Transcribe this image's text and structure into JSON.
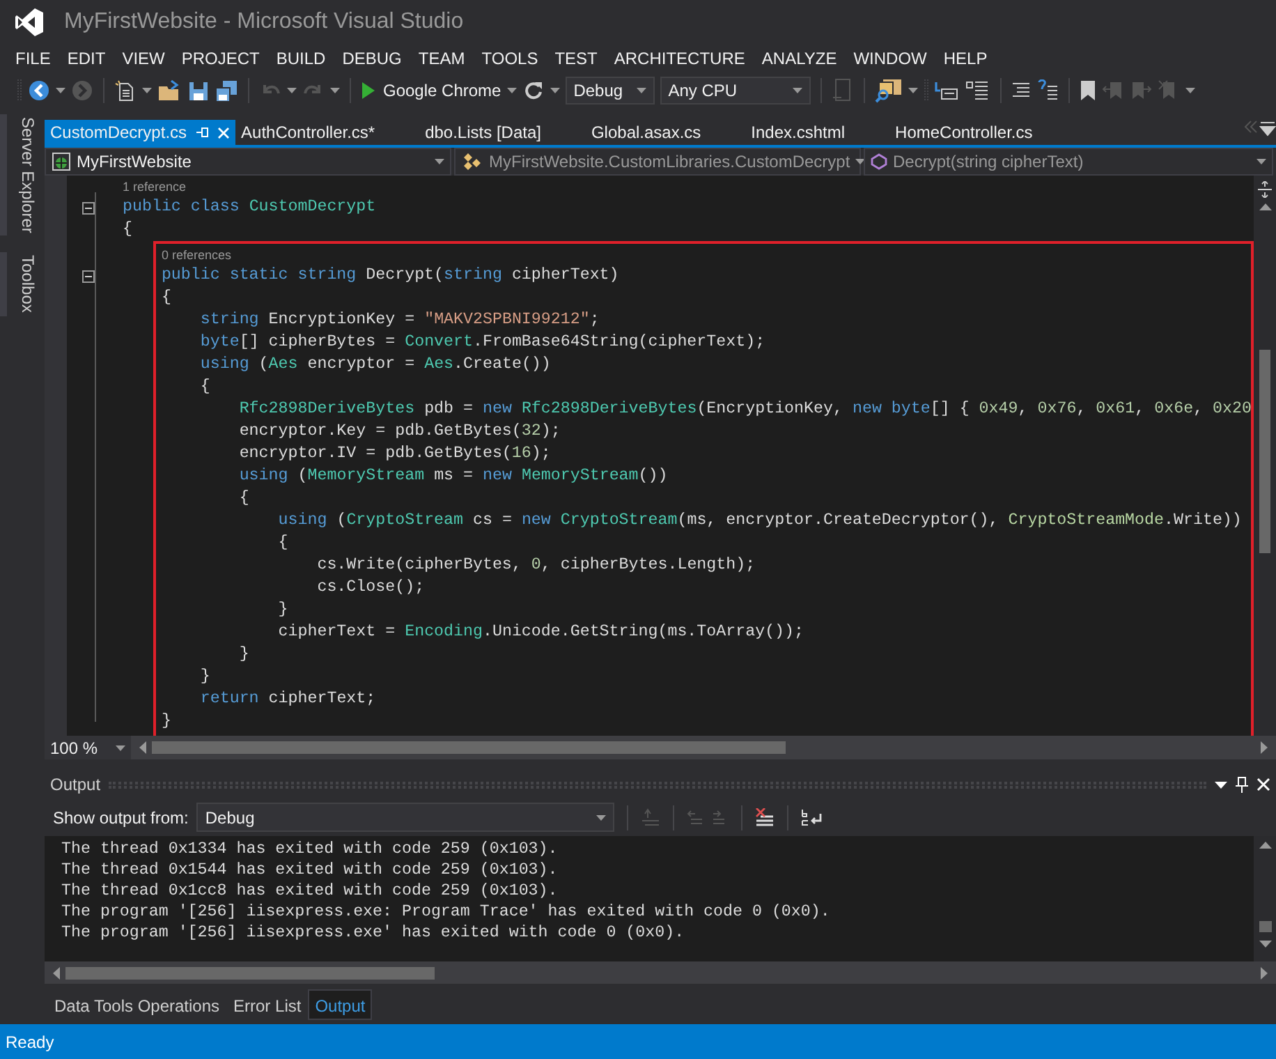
{
  "window": {
    "title": "MyFirstWebsite - Microsoft Visual Studio"
  },
  "menu": [
    "FILE",
    "EDIT",
    "VIEW",
    "PROJECT",
    "BUILD",
    "DEBUG",
    "TEAM",
    "TOOLS",
    "TEST",
    "ARCHITECTURE",
    "ANALYZE",
    "WINDOW",
    "HELP"
  ],
  "toolbar": {
    "run_target": "Google Chrome",
    "configuration": "Debug",
    "platform": "Any CPU"
  },
  "side_tabs": [
    "Server Explorer",
    "Toolbox"
  ],
  "document_tabs": [
    {
      "label": "CustomDecrypt.cs",
      "selected": true
    },
    {
      "label": "AuthController.cs*",
      "selected": false
    },
    {
      "label": "dbo.Lists [Data]",
      "selected": false
    },
    {
      "label": "Global.asax.cs",
      "selected": false
    },
    {
      "label": "Index.cshtml",
      "selected": false
    },
    {
      "label": "HomeController.cs",
      "selected": false
    }
  ],
  "navigation": {
    "project": "MyFirstWebsite",
    "type": "MyFirstWebsite.CustomLibraries.CustomDecrypt",
    "member": "Decrypt(string cipherText)"
  },
  "editor": {
    "zoom": "100 %",
    "lines": [
      {
        "kind": "lens",
        "foldable": false,
        "tokens": [
          {
            "kind": "lens",
            "text": "1 reference"
          }
        ]
      },
      {
        "kind": "code",
        "foldable": true,
        "tokens": [
          {
            "kind": "keyword",
            "text": "public class"
          },
          {
            "kind": "type",
            "text": " CustomDecrypt"
          }
        ]
      },
      {
        "kind": "code",
        "foldable": false,
        "tokens": [
          {
            "kind": "plain",
            "text": "{"
          }
        ]
      },
      {
        "kind": "highlight",
        "children": [
          {
            "kind": "lens",
            "foldable": false,
            "tokens": [
              {
                "kind": "lens",
                "text": "    0 references"
              }
            ]
          },
          {
            "kind": "code",
            "foldable": true,
            "tokens": [
              {
                "kind": "keyword",
                "text": "    public static string"
              },
              {
                "kind": "plain",
                "text": " Decrypt("
              },
              {
                "kind": "keyword",
                "text": "string"
              },
              {
                "kind": "plain",
                "text": " cipherText)"
              }
            ]
          },
          {
            "kind": "code",
            "foldable": false,
            "tokens": [
              {
                "kind": "plain",
                "text": "    {"
              }
            ]
          },
          {
            "kind": "code",
            "foldable": false,
            "tokens": [
              {
                "kind": "keyword",
                "text": "        string"
              },
              {
                "kind": "plain",
                "text": " EncryptionKey = "
              },
              {
                "kind": "string",
                "text": "\"MAKV2SPBNI99212\""
              },
              {
                "kind": "plain",
                "text": ";"
              }
            ]
          },
          {
            "kind": "code",
            "foldable": false,
            "tokens": [
              {
                "kind": "keyword",
                "text": "        byte"
              },
              {
                "kind": "plain",
                "text": "[] cipherBytes = "
              },
              {
                "kind": "type",
                "text": "Convert"
              },
              {
                "kind": "plain",
                "text": ".FromBase64String(cipherText);"
              }
            ]
          },
          {
            "kind": "code",
            "foldable": false,
            "tokens": [
              {
                "kind": "keyword",
                "text": "        using"
              },
              {
                "kind": "plain",
                "text": " ("
              },
              {
                "kind": "type",
                "text": "Aes"
              },
              {
                "kind": "plain",
                "text": " encryptor = "
              },
              {
                "kind": "type",
                "text": "Aes"
              },
              {
                "kind": "plain",
                "text": ".Create())"
              }
            ]
          },
          {
            "kind": "code",
            "foldable": false,
            "tokens": [
              {
                "kind": "plain",
                "text": "        {"
              }
            ]
          },
          {
            "kind": "code",
            "foldable": false,
            "tokens": [
              {
                "kind": "type",
                "text": "            Rfc2898DeriveBytes"
              },
              {
                "kind": "plain",
                "text": " pdb = "
              },
              {
                "kind": "keyword",
                "text": "new"
              },
              {
                "kind": "type",
                "text": " Rfc2898DeriveBytes"
              },
              {
                "kind": "plain",
                "text": "(EncryptionKey, "
              },
              {
                "kind": "keyword",
                "text": "new byte"
              },
              {
                "kind": "plain",
                "text": "[] { "
              },
              {
                "kind": "number",
                "text": "0x49"
              },
              {
                "kind": "plain",
                "text": ", "
              },
              {
                "kind": "number",
                "text": "0x76"
              },
              {
                "kind": "plain",
                "text": ", "
              },
              {
                "kind": "number",
                "text": "0x61"
              },
              {
                "kind": "plain",
                "text": ", "
              },
              {
                "kind": "number",
                "text": "0x6e"
              },
              {
                "kind": "plain",
                "text": ", "
              },
              {
                "kind": "number",
                "text": "0x20"
              }
            ]
          },
          {
            "kind": "code",
            "foldable": false,
            "tokens": [
              {
                "kind": "plain",
                "text": "            encryptor.Key = pdb.GetBytes("
              },
              {
                "kind": "number",
                "text": "32"
              },
              {
                "kind": "plain",
                "text": ");"
              }
            ]
          },
          {
            "kind": "code",
            "foldable": false,
            "tokens": [
              {
                "kind": "plain",
                "text": "            encryptor.IV = pdb.GetBytes("
              },
              {
                "kind": "number",
                "text": "16"
              },
              {
                "kind": "plain",
                "text": ");"
              }
            ]
          },
          {
            "kind": "code",
            "foldable": false,
            "tokens": [
              {
                "kind": "keyword",
                "text": "            using"
              },
              {
                "kind": "plain",
                "text": " ("
              },
              {
                "kind": "type",
                "text": "MemoryStream"
              },
              {
                "kind": "plain",
                "text": " ms = "
              },
              {
                "kind": "keyword",
                "text": "new"
              },
              {
                "kind": "type",
                "text": " MemoryStream"
              },
              {
                "kind": "plain",
                "text": "())"
              }
            ]
          },
          {
            "kind": "code",
            "foldable": false,
            "tokens": [
              {
                "kind": "plain",
                "text": "            {"
              }
            ]
          },
          {
            "kind": "code",
            "foldable": false,
            "tokens": [
              {
                "kind": "keyword",
                "text": "                using"
              },
              {
                "kind": "plain",
                "text": " ("
              },
              {
                "kind": "type",
                "text": "CryptoStream"
              },
              {
                "kind": "plain",
                "text": " cs = "
              },
              {
                "kind": "keyword",
                "text": "new"
              },
              {
                "kind": "type",
                "text": " CryptoStream"
              },
              {
                "kind": "plain",
                "text": "(ms, encryptor.CreateDecryptor(), "
              },
              {
                "kind": "enum",
                "text": "CryptoStreamMode"
              },
              {
                "kind": "plain",
                "text": ".Write))"
              }
            ]
          },
          {
            "kind": "code",
            "foldable": false,
            "tokens": [
              {
                "kind": "plain",
                "text": "                {"
              }
            ]
          },
          {
            "kind": "code",
            "foldable": false,
            "tokens": [
              {
                "kind": "plain",
                "text": "                    cs.Write(cipherBytes, "
              },
              {
                "kind": "number",
                "text": "0"
              },
              {
                "kind": "plain",
                "text": ", cipherBytes.Length);"
              }
            ]
          },
          {
            "kind": "code",
            "foldable": false,
            "tokens": [
              {
                "kind": "plain",
                "text": "                    cs.Close();"
              }
            ]
          },
          {
            "kind": "code",
            "foldable": false,
            "tokens": [
              {
                "kind": "plain",
                "text": "                }"
              }
            ]
          },
          {
            "kind": "code",
            "foldable": false,
            "tokens": [
              {
                "kind": "plain",
                "text": "                cipherText = "
              },
              {
                "kind": "type",
                "text": "Encoding"
              },
              {
                "kind": "plain",
                "text": ".Unicode.GetString(ms.ToArray());"
              }
            ]
          },
          {
            "kind": "code",
            "foldable": false,
            "tokens": [
              {
                "kind": "plain",
                "text": "            }"
              }
            ]
          },
          {
            "kind": "code",
            "foldable": false,
            "tokens": [
              {
                "kind": "plain",
                "text": "        }"
              }
            ]
          },
          {
            "kind": "code",
            "foldable": false,
            "tokens": [
              {
                "kind": "keyword",
                "text": "        return"
              },
              {
                "kind": "plain",
                "text": " cipherText;"
              }
            ]
          },
          {
            "kind": "code",
            "foldable": false,
            "tokens": [
              {
                "kind": "plain",
                "text": "    }"
              }
            ]
          }
        ]
      }
    ]
  },
  "output": {
    "title": "Output",
    "source_label": "Show output from:",
    "source": "Debug",
    "lines": [
      "The thread 0x1334 has exited with code 259 (0x103).",
      "The thread 0x1544 has exited with code 259 (0x103).",
      "The thread 0x1cc8 has exited with code 259 (0x103).",
      "The program '[256] iisexpress.exe: Program Trace' has exited with code 0 (0x0).",
      "The program '[256] iisexpress.exe' has exited with code 0 (0x0)."
    ]
  },
  "bottom_tabs": [
    {
      "label": "Data Tools Operations",
      "selected": false
    },
    {
      "label": "Error List",
      "selected": false
    },
    {
      "label": "Output",
      "selected": true
    }
  ],
  "status_bar": {
    "text": "Ready"
  }
}
